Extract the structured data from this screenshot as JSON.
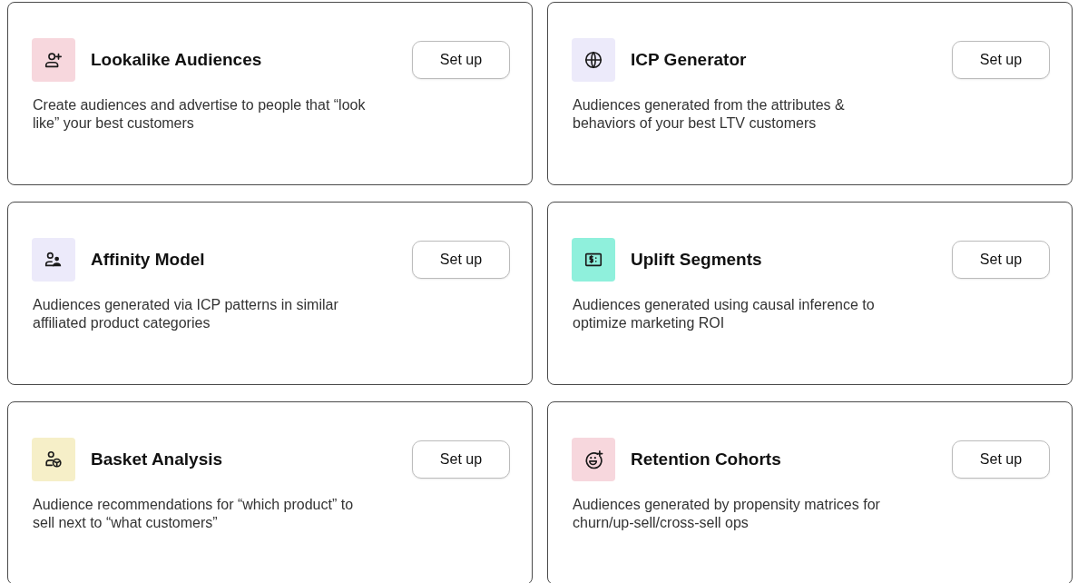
{
  "cards": [
    {
      "title": "Lookalike Audiences",
      "color": "#f7d7dd",
      "description": "Create audiences and advertise to people that “look like” your best customers",
      "button": "Set up"
    },
    {
      "title": "ICP Generator",
      "color": "#eceafa",
      "description": "Audiences generated from the attributes & behaviors of your best LTV customers",
      "button": "Set up"
    },
    {
      "title": "Affinity Model",
      "color": "#eceafa",
      "description": "Audiences generated via ICP patterns in similar affiliated product categories",
      "button": "Set up"
    },
    {
      "title": "Uplift Segments",
      "color": "#8ff0dc",
      "description": "Audiences generated using causal inference to optimize marketing ROI",
      "button": "Set up"
    },
    {
      "title": "Basket Analysis",
      "color": "#f6efc8",
      "description": "Audience recommendations for “which product” to sell next to “what customers”",
      "button": "Set up"
    },
    {
      "title": "Retention Cohorts",
      "color": "#f7d7dd",
      "description": "Audiences generated by propensity matrices for churn/up-sell/cross-sell ops",
      "button": "Set up"
    }
  ]
}
